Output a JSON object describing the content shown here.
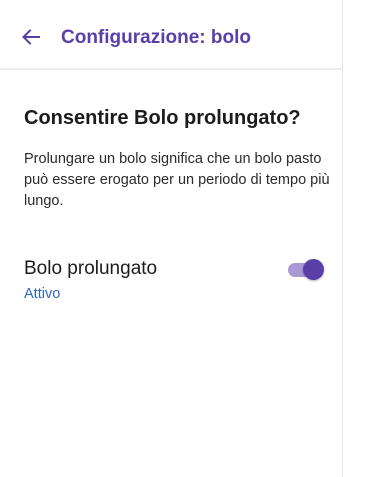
{
  "app_bar": {
    "back_icon": "arrow-left-icon",
    "title": "Configurazione: bolo"
  },
  "content": {
    "headline": "Consentire Bolo prolungato?",
    "description": "Prolungare un bolo significa che un bolo pasto può essere erogato per un periodo di tempo più lungo."
  },
  "setting": {
    "title": "Bolo prolungato",
    "status": "Attivo",
    "enabled": true
  },
  "colors": {
    "accent": "#5b3fa8",
    "track": "#a99ad6",
    "status_link": "#2f66c2"
  }
}
